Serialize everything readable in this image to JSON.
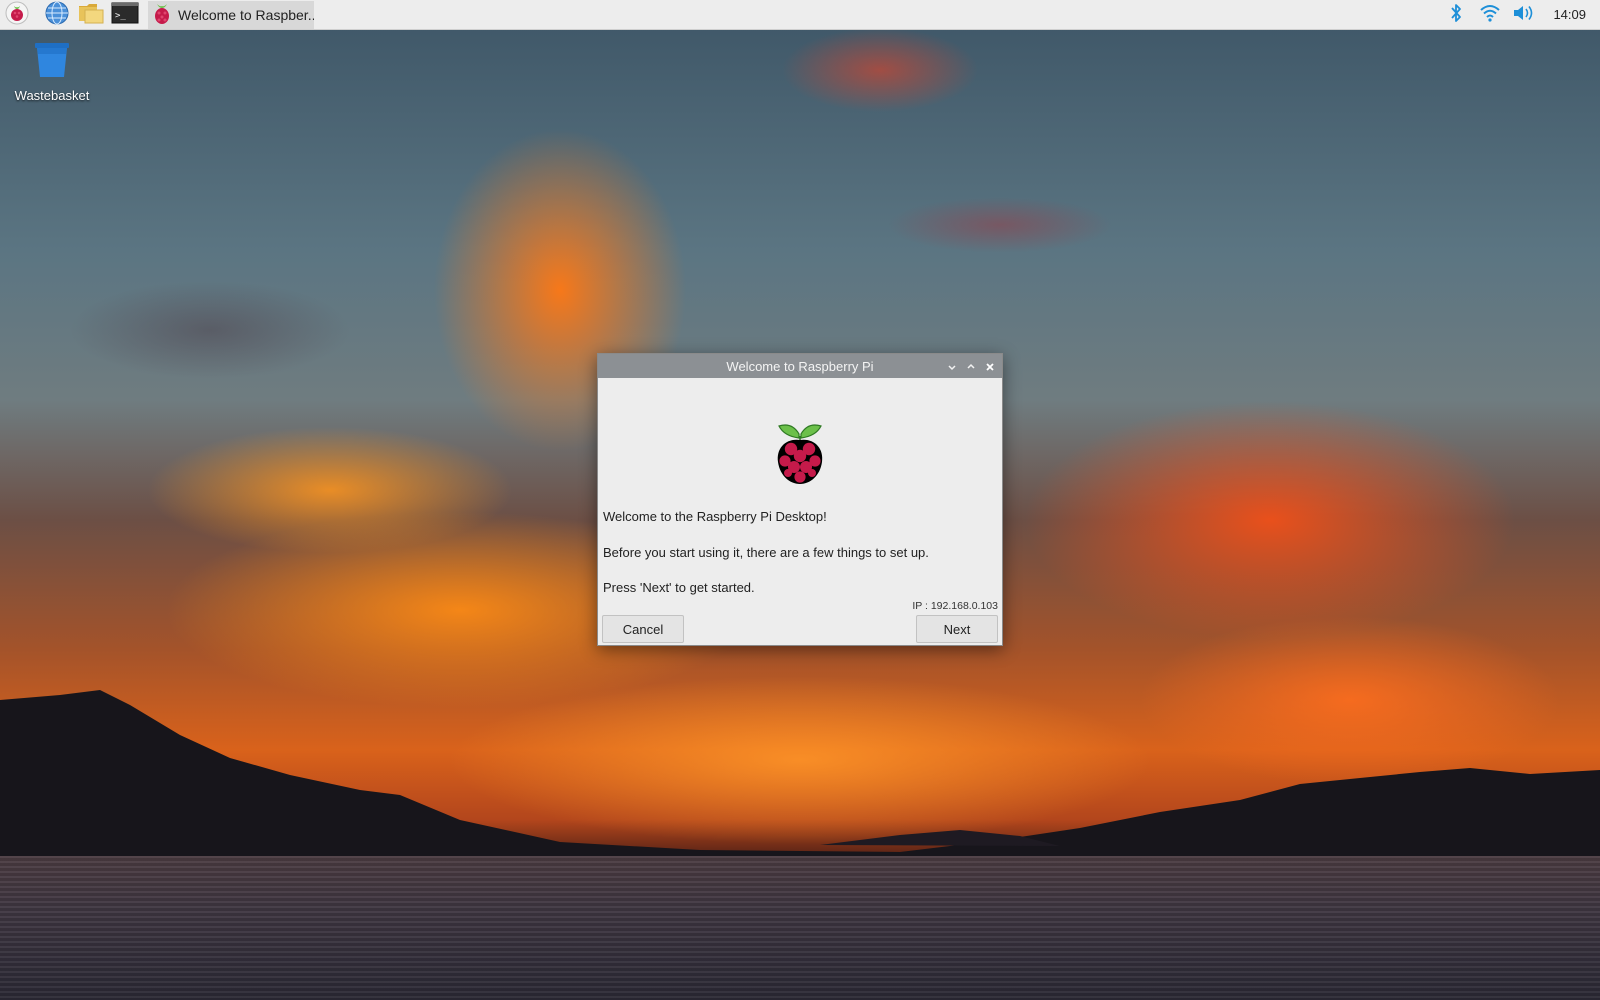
{
  "taskbar": {
    "menu_icon": "raspberry-menu-icon",
    "launchers": [
      {
        "name": "web-browser-icon",
        "color": "#4a90d9"
      },
      {
        "name": "file-manager-icon",
        "color": "#e8c35a"
      },
      {
        "name": "terminal-icon",
        "color": "#2b2b2b"
      }
    ],
    "task": {
      "label": "Welcome to Raspber..."
    },
    "tray": {
      "bluetooth_icon": "bluetooth-icon",
      "wifi_icon": "wifi-icon",
      "volume_icon": "volume-icon",
      "clock": "14:09"
    },
    "accent_color": "#1d8fd8"
  },
  "desktop": {
    "icons": [
      {
        "label": "Wastebasket",
        "icon": "wastebasket-icon"
      }
    ]
  },
  "dialog": {
    "title": "Welcome to Raspberry Pi",
    "controls": [
      "minimize-icon",
      "maximize-icon",
      "close-icon"
    ],
    "logo": "raspberry-pi-logo",
    "messages": [
      "Welcome to the Raspberry Pi Desktop!",
      "Before you start using it, there are a few things to set up.",
      "Press 'Next' to get started."
    ],
    "ip_text": "IP : 192.168.0.103",
    "buttons": {
      "cancel": "Cancel",
      "next": "Next"
    }
  },
  "colors": {
    "raspberry_red": "#c51a4a",
    "leaf_green": "#6cc04a",
    "titlebar": "#8c9094"
  }
}
